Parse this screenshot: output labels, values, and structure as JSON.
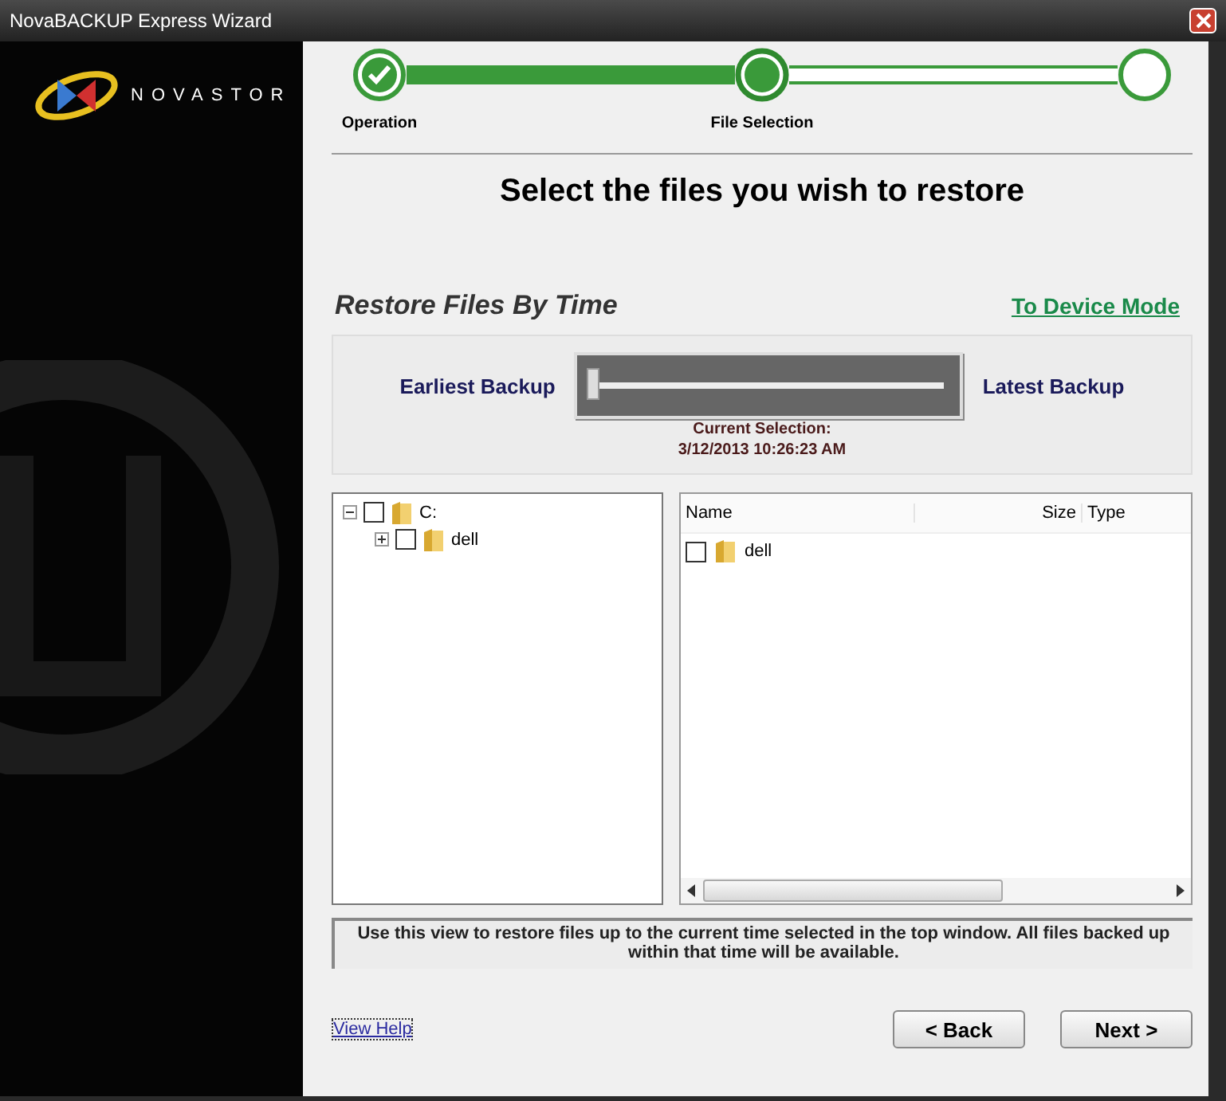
{
  "window": {
    "title": "NovaBACKUP Express Wizard"
  },
  "brand": {
    "name": "NOVASTOR"
  },
  "steps": [
    {
      "label": "Operation",
      "completed": true,
      "selected": false
    },
    {
      "label": "File Selection",
      "completed": false,
      "selected": true
    },
    {
      "completed": false,
      "selected": false
    }
  ],
  "heading": "Select the files you wish to restore",
  "section": {
    "title": "Restore Files By Time",
    "link": "To Device Mode"
  },
  "slider": {
    "start_label": "Earliest Backup",
    "end_label": "Latest Backup",
    "level": 0,
    "caption": "Current Selection:",
    "value": "3/12/2013 10:26:23 AM"
  },
  "tree": [
    {
      "label": "C:",
      "checked": false,
      "expanded": true,
      "children": [
        {
          "label": "dell",
          "checked": false,
          "expanded": false
        }
      ]
    }
  ],
  "list": {
    "columns": [
      "Name",
      "Size",
      "Type"
    ],
    "rows": [
      {
        "name": "dell",
        "checked": false
      }
    ]
  },
  "info": "Use this view to restore files up to the current time selected in the top window. All files backed up within that time will be available.",
  "help_link": "View Help",
  "buttons": [
    "< Back",
    "Next >"
  ]
}
